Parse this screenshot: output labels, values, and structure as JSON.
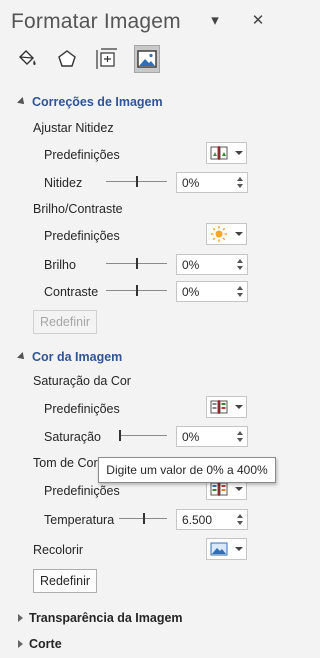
{
  "pane": {
    "title": "Formatar Imagem",
    "dropdown_glyph": "▾",
    "close_glyph": "✕"
  },
  "tabs": [
    {
      "name": "fill-line",
      "icon": "paint-bucket-icon"
    },
    {
      "name": "effects",
      "icon": "pentagon-icon"
    },
    {
      "name": "size-properties",
      "icon": "size-properties-icon"
    },
    {
      "name": "picture",
      "icon": "picture-icon",
      "active": true
    }
  ],
  "corrections": {
    "header": "Correções de Imagem",
    "sharpen_label": "Ajustar Nitidez",
    "sharpen_presets_label": "Predefinições",
    "sharpness_label": "Nitidez",
    "sharpness_value": "0%",
    "brightness_contrast_label": "Brilho/Contraste",
    "bc_presets_label": "Predefinições",
    "brightness_label": "Brilho",
    "brightness_value": "0%",
    "contrast_label": "Contraste",
    "contrast_value": "0%",
    "reset_label": "Redefinir"
  },
  "color": {
    "header": "Cor da Imagem",
    "saturation_heading": "Saturação da Cor",
    "saturation_presets_label": "Predefinições",
    "saturation_label": "Saturação",
    "saturation_value": "0%",
    "tone_heading": "Tom de Cor",
    "tone_presets_label": "Predefinições",
    "temperature_label": "Temperatura",
    "temperature_value": "6.500",
    "recolor_label": "Recolorir",
    "reset_label": "Redefinir"
  },
  "tooltip": "Digite um valor de 0% a 400%",
  "collapsed_sections": {
    "transparency": "Transparência da Imagem",
    "crop": "Corte"
  },
  "colors": {
    "section_header": "#2f5597",
    "pane_background": "#f3f3f3"
  }
}
